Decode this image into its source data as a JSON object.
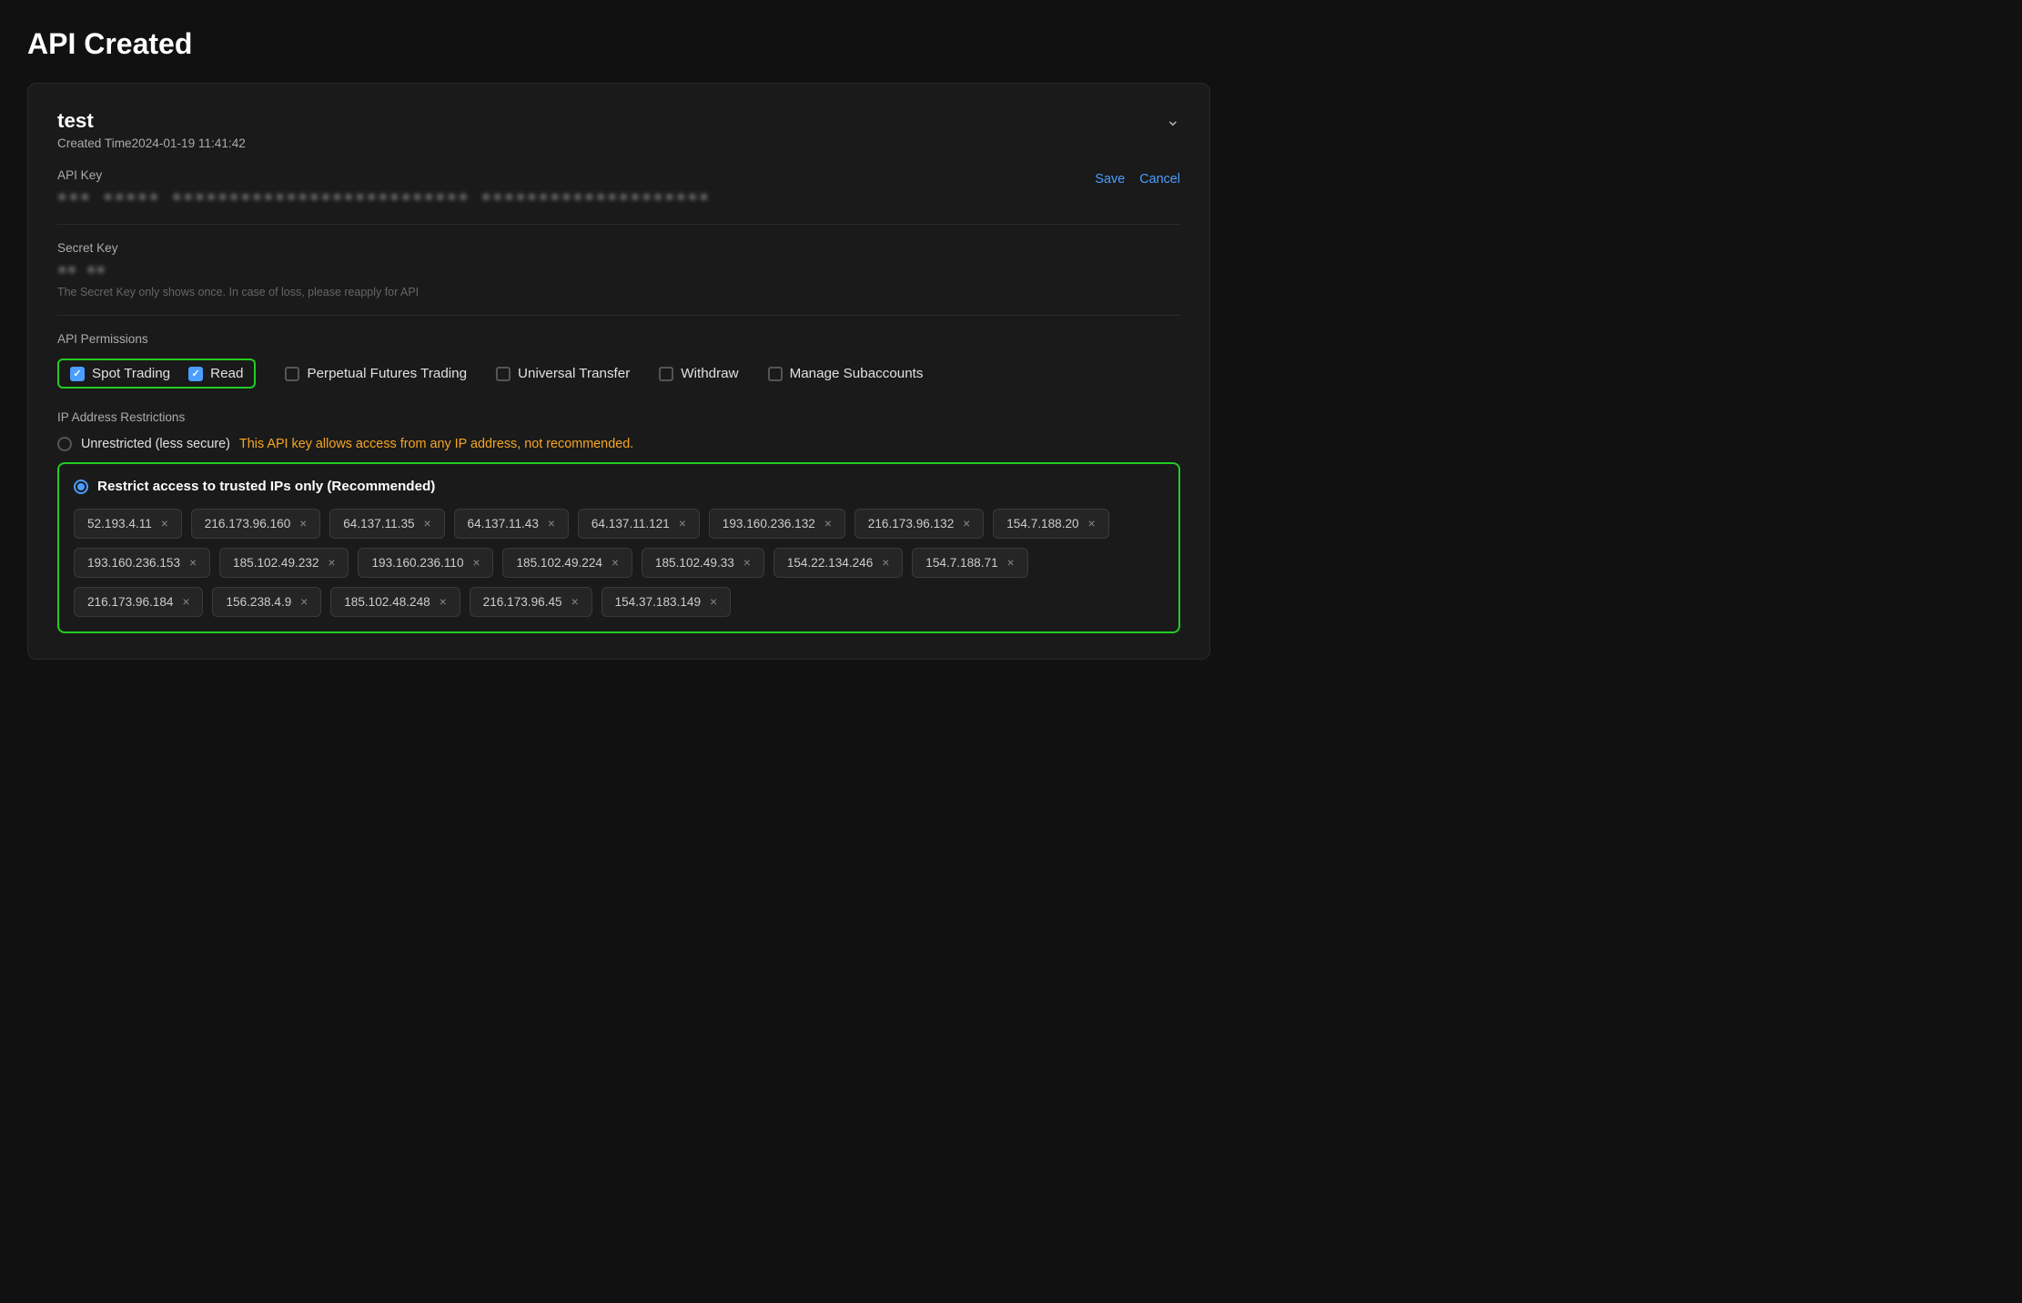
{
  "page": {
    "title": "API Created"
  },
  "api": {
    "name": "test",
    "created_label": "Created Time",
    "created_time": "2024-01-19 11:41:42",
    "api_key_label": "API Key",
    "api_key_value": "••• ••••• •••••••••••••••••••••••••• ••••••••••••••••••••",
    "secret_key_label": "Secret Key",
    "secret_key_value": "•• ••",
    "secret_note": "The Secret Key only shows once. In case of loss, please reapply for API",
    "save_label": "Save",
    "cancel_label": "Cancel"
  },
  "permissions": {
    "section_label": "API Permissions",
    "items": [
      {
        "id": "spot-trading",
        "label": "Spot Trading",
        "checked": true,
        "highlighted": true
      },
      {
        "id": "read",
        "label": "Read",
        "checked": true,
        "highlighted": true
      },
      {
        "id": "perpetual-futures",
        "label": "Perpetual Futures Trading",
        "checked": false,
        "highlighted": false
      },
      {
        "id": "universal-transfer",
        "label": "Universal Transfer",
        "checked": false,
        "highlighted": false
      },
      {
        "id": "withdraw",
        "label": "Withdraw",
        "checked": false,
        "highlighted": false
      },
      {
        "id": "manage-subaccounts",
        "label": "Manage Subaccounts",
        "checked": false,
        "highlighted": false
      }
    ]
  },
  "ip_restrictions": {
    "section_label": "IP Address Restrictions",
    "unrestricted_label": "Unrestricted (less secure)",
    "unrestricted_warning": "This API key allows access from any IP address, not recommended.",
    "restricted_label": "Restrict access to trusted IPs only (Recommended)",
    "selected": "restricted",
    "ips": [
      "52.193.4.11",
      "216.173.96.160",
      "64.137.11.35",
      "64.137.11.43",
      "64.137.11.121",
      "193.160.236.132",
      "216.173.96.132",
      "154.7.188.20",
      "193.160.236.153",
      "185.102.49.232",
      "193.160.236.110",
      "185.102.49.224",
      "185.102.49.33",
      "154.22.134.246",
      "154.7.188.71",
      "216.173.96.184",
      "156.238.4.9",
      "185.102.48.248",
      "216.173.96.45",
      "154.37.183.149"
    ]
  }
}
